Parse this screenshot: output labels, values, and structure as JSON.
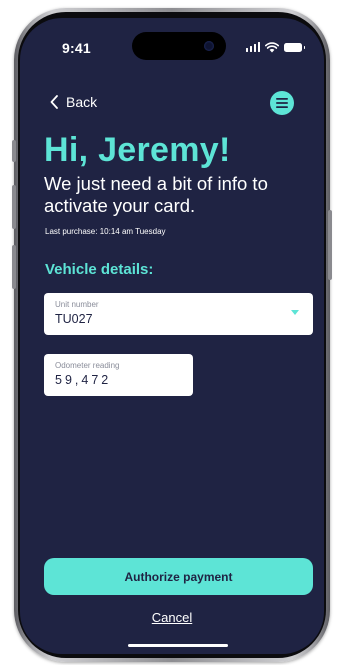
{
  "status_bar": {
    "time": "9:41"
  },
  "nav": {
    "back_label": "Back",
    "back_icon": "chevron-left-icon",
    "menu_icon": "menu-icon"
  },
  "header": {
    "greeting": "Hi, Jeremy!",
    "subtitle": "We just need a bit of info to activate your card.",
    "last_purchase": "Last purchase: 10:14 am Tuesday"
  },
  "vehicle": {
    "section_title": "Vehicle details:",
    "unit_number": {
      "label": "Unit number",
      "value": "TU027"
    },
    "odometer": {
      "label": "Odometer reading",
      "value": "59,472"
    }
  },
  "actions": {
    "authorize_label": "Authorize payment",
    "cancel_label": "Cancel"
  },
  "colors": {
    "background": "#1f2343",
    "accent": "#5de4d6",
    "field_background": "#ffffff",
    "text_primary": "#ffffff"
  }
}
